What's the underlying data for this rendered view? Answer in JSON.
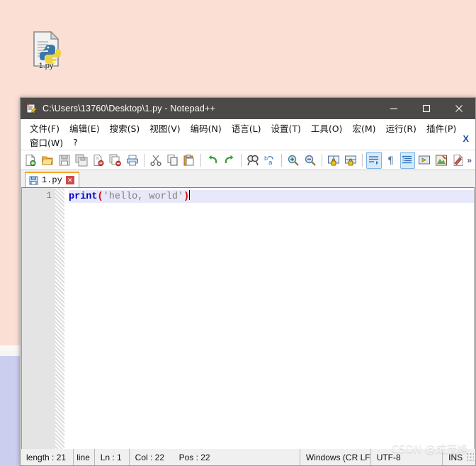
{
  "desktop": {
    "icon": {
      "name": "python-file-icon",
      "label": "1.py"
    },
    "colors": {
      "top": "#fbdfd5",
      "stripe": "#fdfbf8",
      "bottom": "#ccceef"
    }
  },
  "window": {
    "title": "C:\\Users\\13760\\Desktop\\1.py - Notepad++",
    "icon": "notepad-plus-plus-icon",
    "controls": {
      "minimize": "–",
      "maximize": "☐",
      "close": "✕"
    },
    "titlebar_color": "#4c4a48"
  },
  "menu": {
    "row1": [
      {
        "label": "文件(F)",
        "name": "menu-file"
      },
      {
        "label": "编辑(E)",
        "name": "menu-edit"
      },
      {
        "label": "搜索(S)",
        "name": "menu-search"
      },
      {
        "label": "视图(V)",
        "name": "menu-view"
      },
      {
        "label": "编码(N)",
        "name": "menu-encoding"
      },
      {
        "label": "语言(L)",
        "name": "menu-language"
      },
      {
        "label": "设置(T)",
        "name": "menu-settings"
      },
      {
        "label": "工具(O)",
        "name": "menu-tools"
      },
      {
        "label": "宏(M)",
        "name": "menu-macro"
      },
      {
        "label": "运行(R)",
        "name": "menu-run"
      },
      {
        "label": "插件(P)",
        "name": "menu-plugins"
      }
    ],
    "row2": [
      {
        "label": "窗口(W)",
        "name": "menu-window"
      },
      {
        "label": "?",
        "name": "menu-help"
      }
    ],
    "doc_close": "X"
  },
  "toolbar": {
    "overflow": "»",
    "buttons": [
      {
        "name": "new-file-icon",
        "glyph": "new"
      },
      {
        "name": "open-file-icon",
        "glyph": "open"
      },
      {
        "name": "save-icon",
        "glyph": "save"
      },
      {
        "name": "save-all-icon",
        "glyph": "saveall"
      },
      {
        "name": "close-file-icon",
        "glyph": "closefile"
      },
      {
        "name": "close-all-files-icon",
        "glyph": "closeall"
      },
      {
        "name": "print-icon",
        "glyph": "print"
      },
      {
        "name": "separator",
        "glyph": "sep"
      },
      {
        "name": "cut-icon",
        "glyph": "cut"
      },
      {
        "name": "copy-icon",
        "glyph": "copy"
      },
      {
        "name": "paste-icon",
        "glyph": "paste"
      },
      {
        "name": "separator",
        "glyph": "sep"
      },
      {
        "name": "undo-icon",
        "glyph": "undo"
      },
      {
        "name": "redo-icon",
        "glyph": "redo"
      },
      {
        "name": "separator",
        "glyph": "sep"
      },
      {
        "name": "find-icon",
        "glyph": "find"
      },
      {
        "name": "replace-icon",
        "glyph": "replace"
      },
      {
        "name": "separator",
        "glyph": "sep"
      },
      {
        "name": "zoom-in-icon",
        "glyph": "zoomin"
      },
      {
        "name": "zoom-out-icon",
        "glyph": "zoomout"
      },
      {
        "name": "separator",
        "glyph": "sep"
      },
      {
        "name": "sync-vertical-scroll-icon",
        "glyph": "syncv"
      },
      {
        "name": "sync-horizontal-scroll-icon",
        "glyph": "synch"
      },
      {
        "name": "separator",
        "glyph": "sep"
      },
      {
        "name": "word-wrap-icon",
        "glyph": "wrap",
        "active": true
      },
      {
        "name": "show-all-characters-icon",
        "glyph": "pilcrow"
      },
      {
        "name": "indent-guide-icon",
        "glyph": "indent",
        "active": true
      },
      {
        "name": "show-ui-icon",
        "glyph": "ui"
      },
      {
        "name": "record-macro-icon",
        "glyph": "recmacro"
      },
      {
        "name": "stop-macro-icon",
        "glyph": "stopmacro"
      }
    ]
  },
  "tabs": [
    {
      "label": "1.py",
      "name": "tab-1-py",
      "saved_icon": "floppy-icon",
      "close": "✕"
    }
  ],
  "editor": {
    "line_numbers": [
      "1"
    ],
    "code": {
      "fn": "print",
      "open_paren": "(",
      "string": "'hello, world'",
      "close_paren": ")"
    },
    "colors": {
      "function": "#0000c0",
      "paren": "#e00000",
      "string": "#808080",
      "current_line": "#e8e8fb"
    }
  },
  "statusbar": {
    "length": "length : 21",
    "lines": "line",
    "ln": "Ln : 1",
    "col": "Col : 22",
    "pos": "Pos : 22",
    "eol": "Windows (CR LF)",
    "encoding": "UTF-8",
    "mode": "INS"
  },
  "watermark": "CSDN @成茂峰"
}
